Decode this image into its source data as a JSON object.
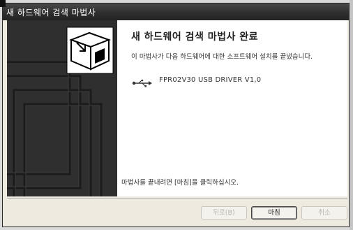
{
  "window": {
    "title": "새 하드웨어 검색 마법사"
  },
  "wizard": {
    "heading": "새 하드웨어 검색 마법사 완료",
    "description": "이 마법사가 다음 하드웨어에 대한 소프트웨어 설치를 끝냈습니다.",
    "device_icon": "usb-icon",
    "device_name": "FPR02V30 USB DRIVER V1,0",
    "finish_hint": "마법사를 끝내려면 [마침]을 클릭하십시오."
  },
  "buttons": {
    "back_label": "뒤로(B)",
    "finish_label": "마침",
    "cancel_label": "취소"
  },
  "colors": {
    "title_bar": "#2e2e2e",
    "side_panel": "#2f2f2f",
    "dialog_bg": "#eeeae0"
  }
}
